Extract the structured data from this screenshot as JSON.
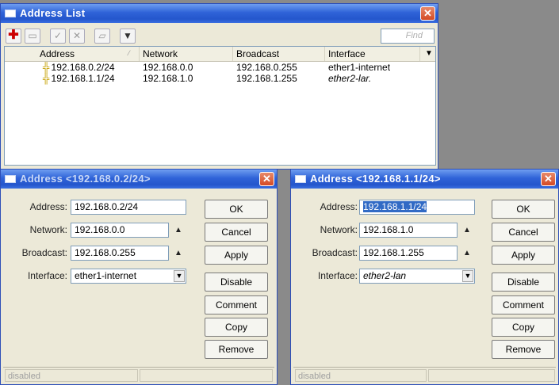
{
  "list_window": {
    "title": "Address List",
    "close_glyph": "✕",
    "find_placeholder": "Find",
    "columns": [
      "Address",
      "Network",
      "Broadcast",
      "Interface"
    ],
    "rows": [
      {
        "address": "192.168.0.2/24",
        "network": "192.168.0.0",
        "broadcast": "192.168.0.255",
        "interface": "ether1-internet"
      },
      {
        "address": "192.168.1.1/24",
        "network": "192.168.1.0",
        "broadcast": "192.168.1.255",
        "interface": "ether2-lar."
      }
    ]
  },
  "dialog1": {
    "title": "Address <192.168.0.2/24>",
    "labels": {
      "address": "Address:",
      "network": "Network:",
      "broadcast": "Broadcast:",
      "interface": "Interface:"
    },
    "values": {
      "address": "192.168.0.2/24",
      "network": "192.168.0.0",
      "broadcast": "192.168.0.255",
      "interface": "ether1-internet"
    },
    "buttons": {
      "ok": "OK",
      "cancel": "Cancel",
      "apply": "Apply",
      "disable": "Disable",
      "comment": "Comment",
      "copy": "Copy",
      "remove": "Remove"
    },
    "status": "disabled"
  },
  "dialog2": {
    "title": "Address <192.168.1.1/24>",
    "labels": {
      "address": "Address:",
      "network": "Network:",
      "broadcast": "Broadcast:",
      "interface": "Interface:"
    },
    "values": {
      "address": "192.168.1.1/24",
      "network": "192.168.1.0",
      "broadcast": "192.168.1.255",
      "interface": "ether2-lan"
    },
    "buttons": {
      "ok": "OK",
      "cancel": "Cancel",
      "apply": "Apply",
      "disable": "Disable",
      "comment": "Comment",
      "copy": "Copy",
      "remove": "Remove"
    },
    "status": "disabled"
  },
  "colors": {
    "titlebar": "#2456cc",
    "close": "#d44a24",
    "add_icon": "#cc0000",
    "selection": "#316ac5"
  }
}
